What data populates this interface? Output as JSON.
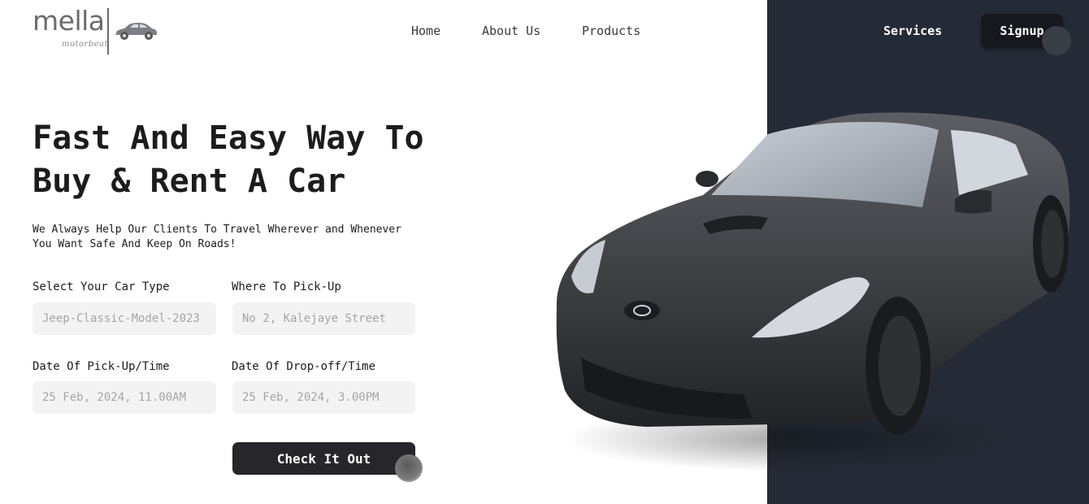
{
  "brand": {
    "name": "mella",
    "tagline": "motorbeat"
  },
  "nav": {
    "home": "Home",
    "about": "About Us",
    "products": "Products",
    "services": "Services",
    "signup": "Signup"
  },
  "hero": {
    "title_line1": "Fast And Easy Way To",
    "title_line2": "Buy & Rent A Car",
    "subtitle_line1": "We Always Help Our Clients To Travel Wherever and Whenever",
    "subtitle_line2": "You Want Safe And Keep On Roads!"
  },
  "form": {
    "car_type": {
      "label": "Select Your Car Type",
      "placeholder": "Jeep-Classic-Model-2023"
    },
    "pickup_location": {
      "label": "Where To Pick-Up",
      "placeholder": "No 2, Kalejaye Street"
    },
    "pickup_date": {
      "label": "Date Of Pick-Up/Time",
      "placeholder": "25 Feb, 2024, 11.00AM"
    },
    "dropoff_date": {
      "label": "Date Of Drop-off/Time",
      "placeholder": "25 Feb, 2024, 3.00PM"
    },
    "submit": "Check It Out"
  },
  "colors": {
    "dark_panel": "#252b36",
    "button": "#26262b",
    "input_bg": "#f3f3f3"
  },
  "icons": {
    "logo_car": "car-icon",
    "hero_image": "sports-car-image"
  }
}
